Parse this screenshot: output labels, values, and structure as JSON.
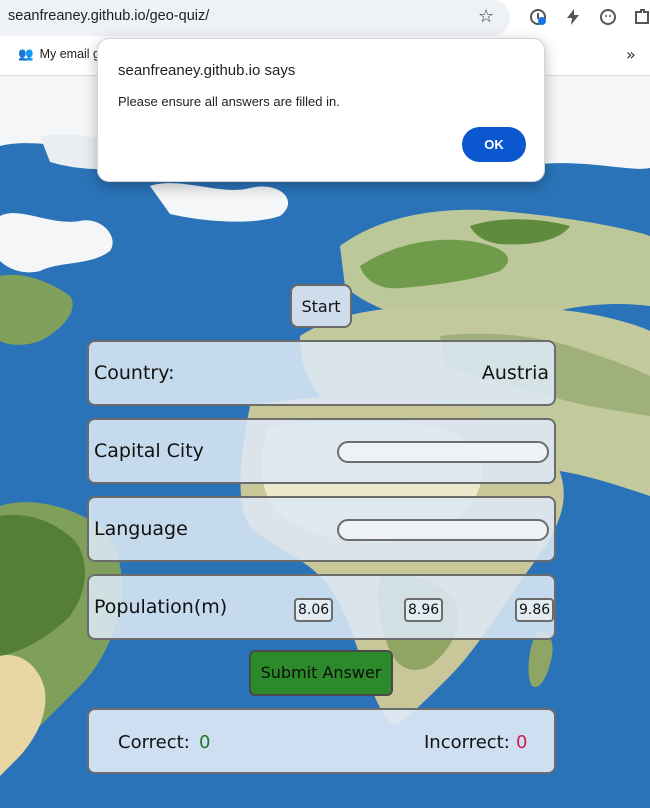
{
  "browser": {
    "url": "seanfreaney.github.io/geo-quiz/",
    "bookmark": "My email g"
  },
  "game": {
    "start_label": "Start",
    "country_label": "Country:",
    "country_value": "Austria",
    "capital_label": "Capital City",
    "capital_value": "",
    "language_label": "Language",
    "language_value": "",
    "population_label": "Population(m)",
    "population_options": [
      "8.06",
      "8.96",
      "9.86"
    ],
    "submit_label": "Submit Answer",
    "correct_label": "Correct:",
    "correct_value": "0",
    "incorrect_label": "Incorrect:",
    "incorrect_value": "0"
  },
  "dialog": {
    "title": "seanfreaney.github.io says",
    "message": "Please ensure all answers are filled in.",
    "ok_label": "OK"
  },
  "colors": {
    "ocean": "#2a73b8",
    "correct": "#1e7a1e",
    "incorrect": "#d8174a",
    "submit": "#2d8a2a",
    "dialog_button": "#0b57d0"
  }
}
